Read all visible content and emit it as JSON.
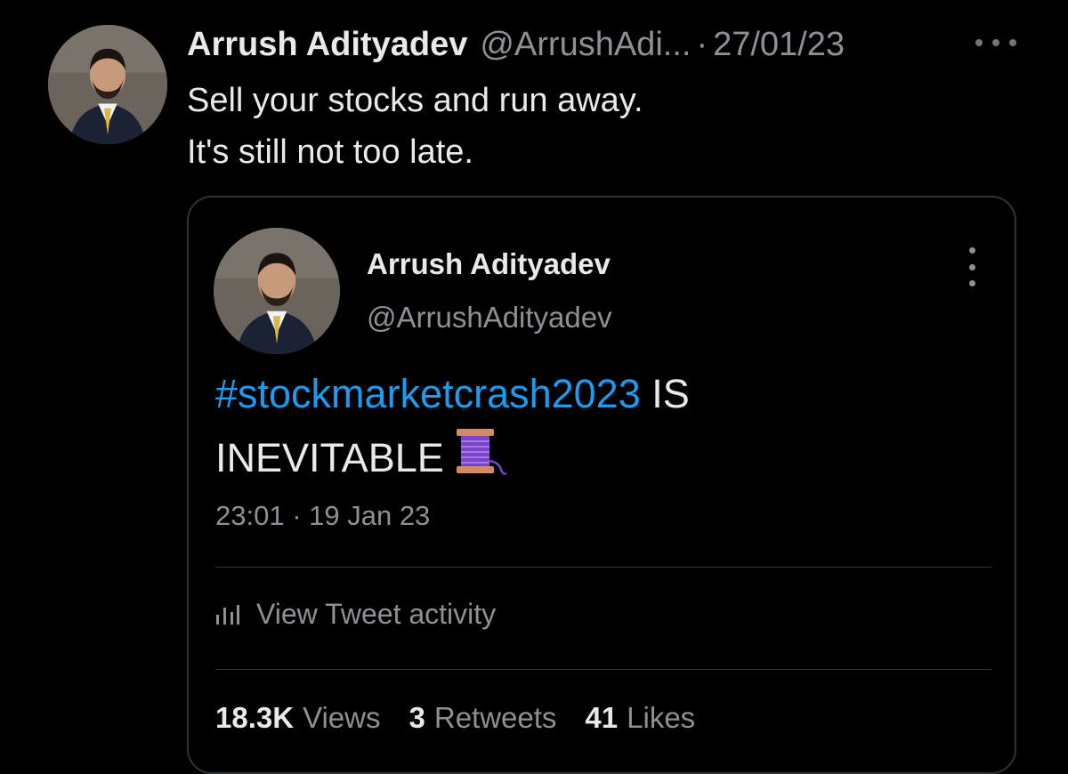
{
  "tweet": {
    "author_name": "Arrush Adityadev",
    "author_handle": "@ArrushAdi...",
    "separator": "·",
    "date": "27/01/23",
    "text_lines": [
      "Sell your stocks and run away.",
      "It's still not too late."
    ],
    "more_icon": "more-horizontal-icon",
    "avatar_icon": "profile-photo"
  },
  "quote": {
    "author_name": "Arrush Adityadev",
    "author_handle": "@ArrushAdityadev",
    "hashtag": "#stockmarketcrash2023",
    "text_after_hashtag": " IS",
    "text_line2": "INEVITABLE",
    "emoji": "spool-of-thread-icon",
    "timestamp": "23:01 · 19 Jan 23",
    "more_icon": "more-vertical-icon",
    "activity_label": "View Tweet activity",
    "activity_icon": "bar-chart-icon",
    "stats": [
      {
        "value": "18.3K",
        "label": "Views"
      },
      {
        "value": "3",
        "label": "Retweets"
      },
      {
        "value": "41",
        "label": "Likes"
      }
    ]
  },
  "colors": {
    "background": "#000000",
    "text": "#e7e9ea",
    "muted": "#8b9197",
    "hashtag": "#1d9bf0",
    "border": "#2f3336"
  }
}
